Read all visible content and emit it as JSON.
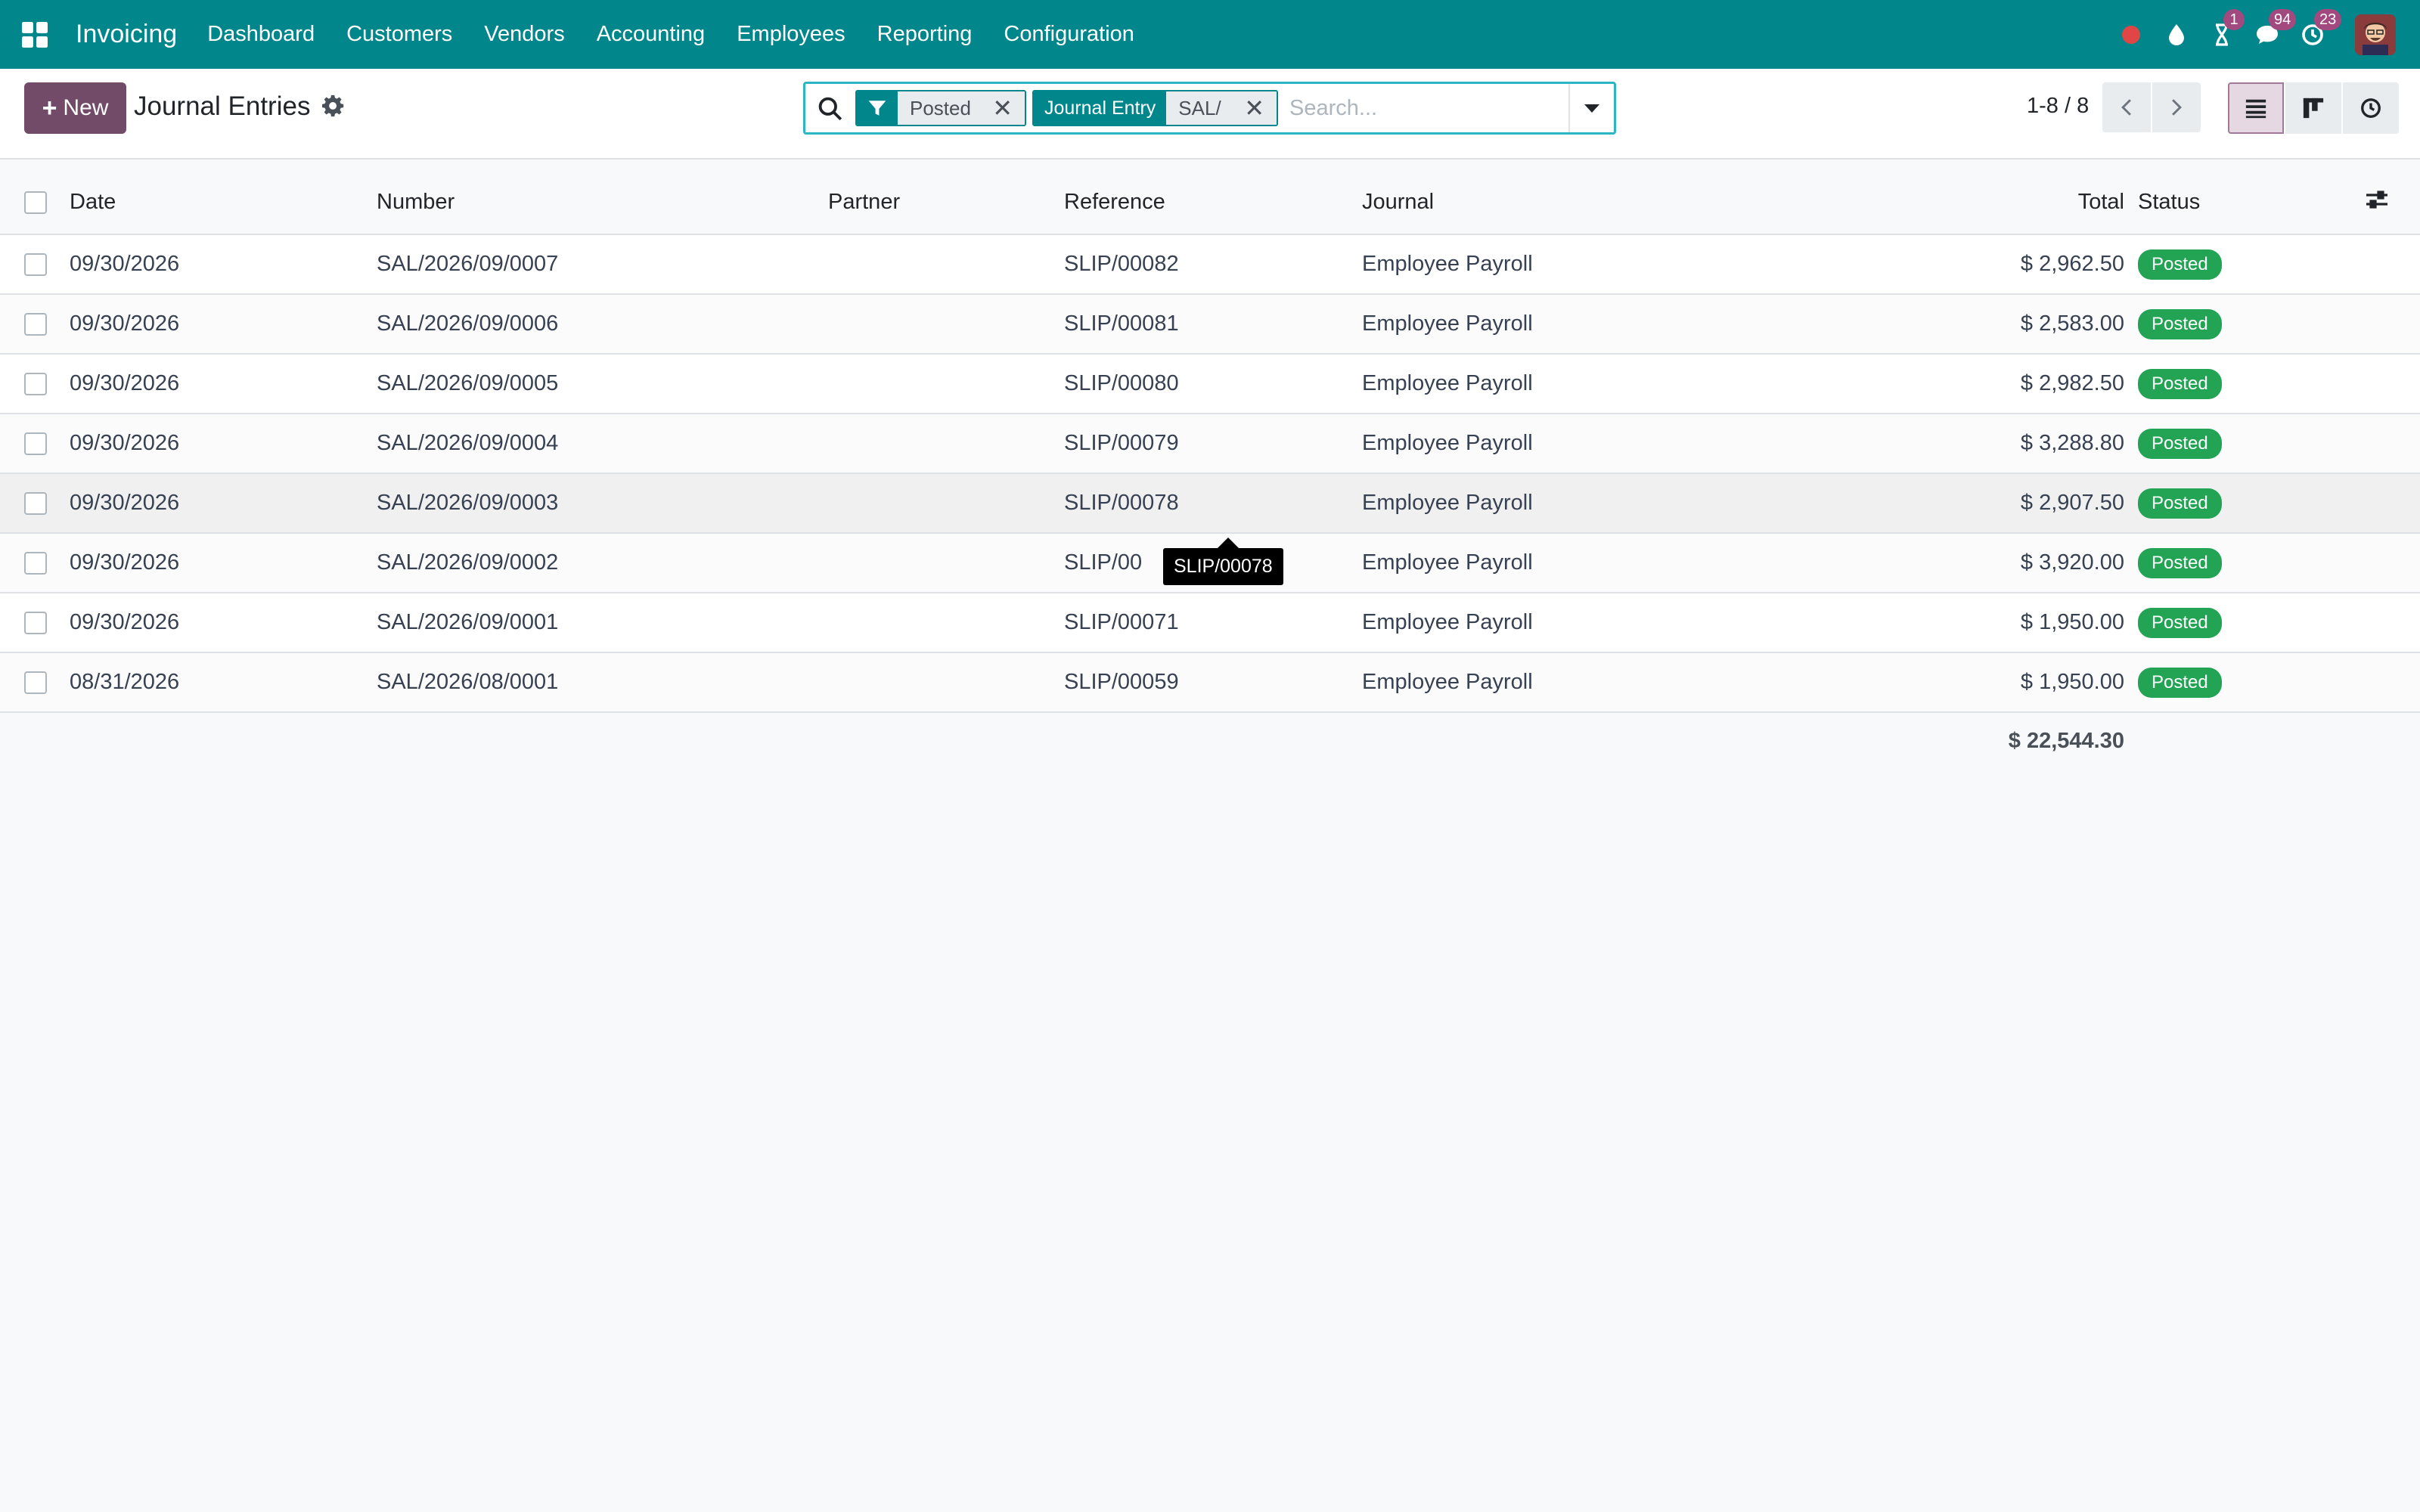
{
  "navbar": {
    "app_name": "Invoicing",
    "menu": [
      "Dashboard",
      "Customers",
      "Vendors",
      "Accounting",
      "Employees",
      "Reporting",
      "Configuration"
    ],
    "badges": {
      "activities": "1",
      "messages": "94",
      "updates": "23"
    }
  },
  "control_panel": {
    "new_label": "New",
    "title": "Journal Entries",
    "search": {
      "facets": [
        {
          "label_icon": "filter-icon",
          "value": "Posted"
        },
        {
          "label": "Journal Entry",
          "value": "SAL/"
        }
      ],
      "placeholder": "Search..."
    },
    "pager": "1-8 / 8"
  },
  "table": {
    "columns": [
      "Date",
      "Number",
      "Partner",
      "Reference",
      "Journal",
      "Total",
      "Status"
    ],
    "rows": [
      {
        "date": "09/30/2026",
        "number": "SAL/2026/09/0007",
        "partner": "",
        "reference": "SLIP/00082",
        "journal": "Employee Payroll",
        "total": "$ 2,962.50",
        "status": "Posted"
      },
      {
        "date": "09/30/2026",
        "number": "SAL/2026/09/0006",
        "partner": "",
        "reference": "SLIP/00081",
        "journal": "Employee Payroll",
        "total": "$ 2,583.00",
        "status": "Posted"
      },
      {
        "date": "09/30/2026",
        "number": "SAL/2026/09/0005",
        "partner": "",
        "reference": "SLIP/00080",
        "journal": "Employee Payroll",
        "total": "$ 2,982.50",
        "status": "Posted"
      },
      {
        "date": "09/30/2026",
        "number": "SAL/2026/09/0004",
        "partner": "",
        "reference": "SLIP/00079",
        "journal": "Employee Payroll",
        "total": "$ 3,288.80",
        "status": "Posted"
      },
      {
        "date": "09/30/2026",
        "number": "SAL/2026/09/0003",
        "partner": "",
        "reference": "SLIP/00078",
        "journal": "Employee Payroll",
        "total": "$ 2,907.50",
        "status": "Posted"
      },
      {
        "date": "09/30/2026",
        "number": "SAL/2026/09/0002",
        "partner": "",
        "reference": "SLIP/00",
        "journal": "Employee Payroll",
        "total": "$ 3,920.00",
        "status": "Posted"
      },
      {
        "date": "09/30/2026",
        "number": "SAL/2026/09/0001",
        "partner": "",
        "reference": "SLIP/00071",
        "journal": "Employee Payroll",
        "total": "$ 1,950.00",
        "status": "Posted"
      },
      {
        "date": "08/31/2026",
        "number": "SAL/2026/08/0001",
        "partner": "",
        "reference": "SLIP/00059",
        "journal": "Employee Payroll",
        "total": "$ 1,950.00",
        "status": "Posted"
      }
    ],
    "sum_total": "$ 22,544.30"
  },
  "tooltip": {
    "text": "SLIP/00078"
  },
  "colors": {
    "navbar": "#00868b",
    "primary": "#714b67",
    "posted_badge": "#23a455",
    "badge": "#a2497f"
  }
}
